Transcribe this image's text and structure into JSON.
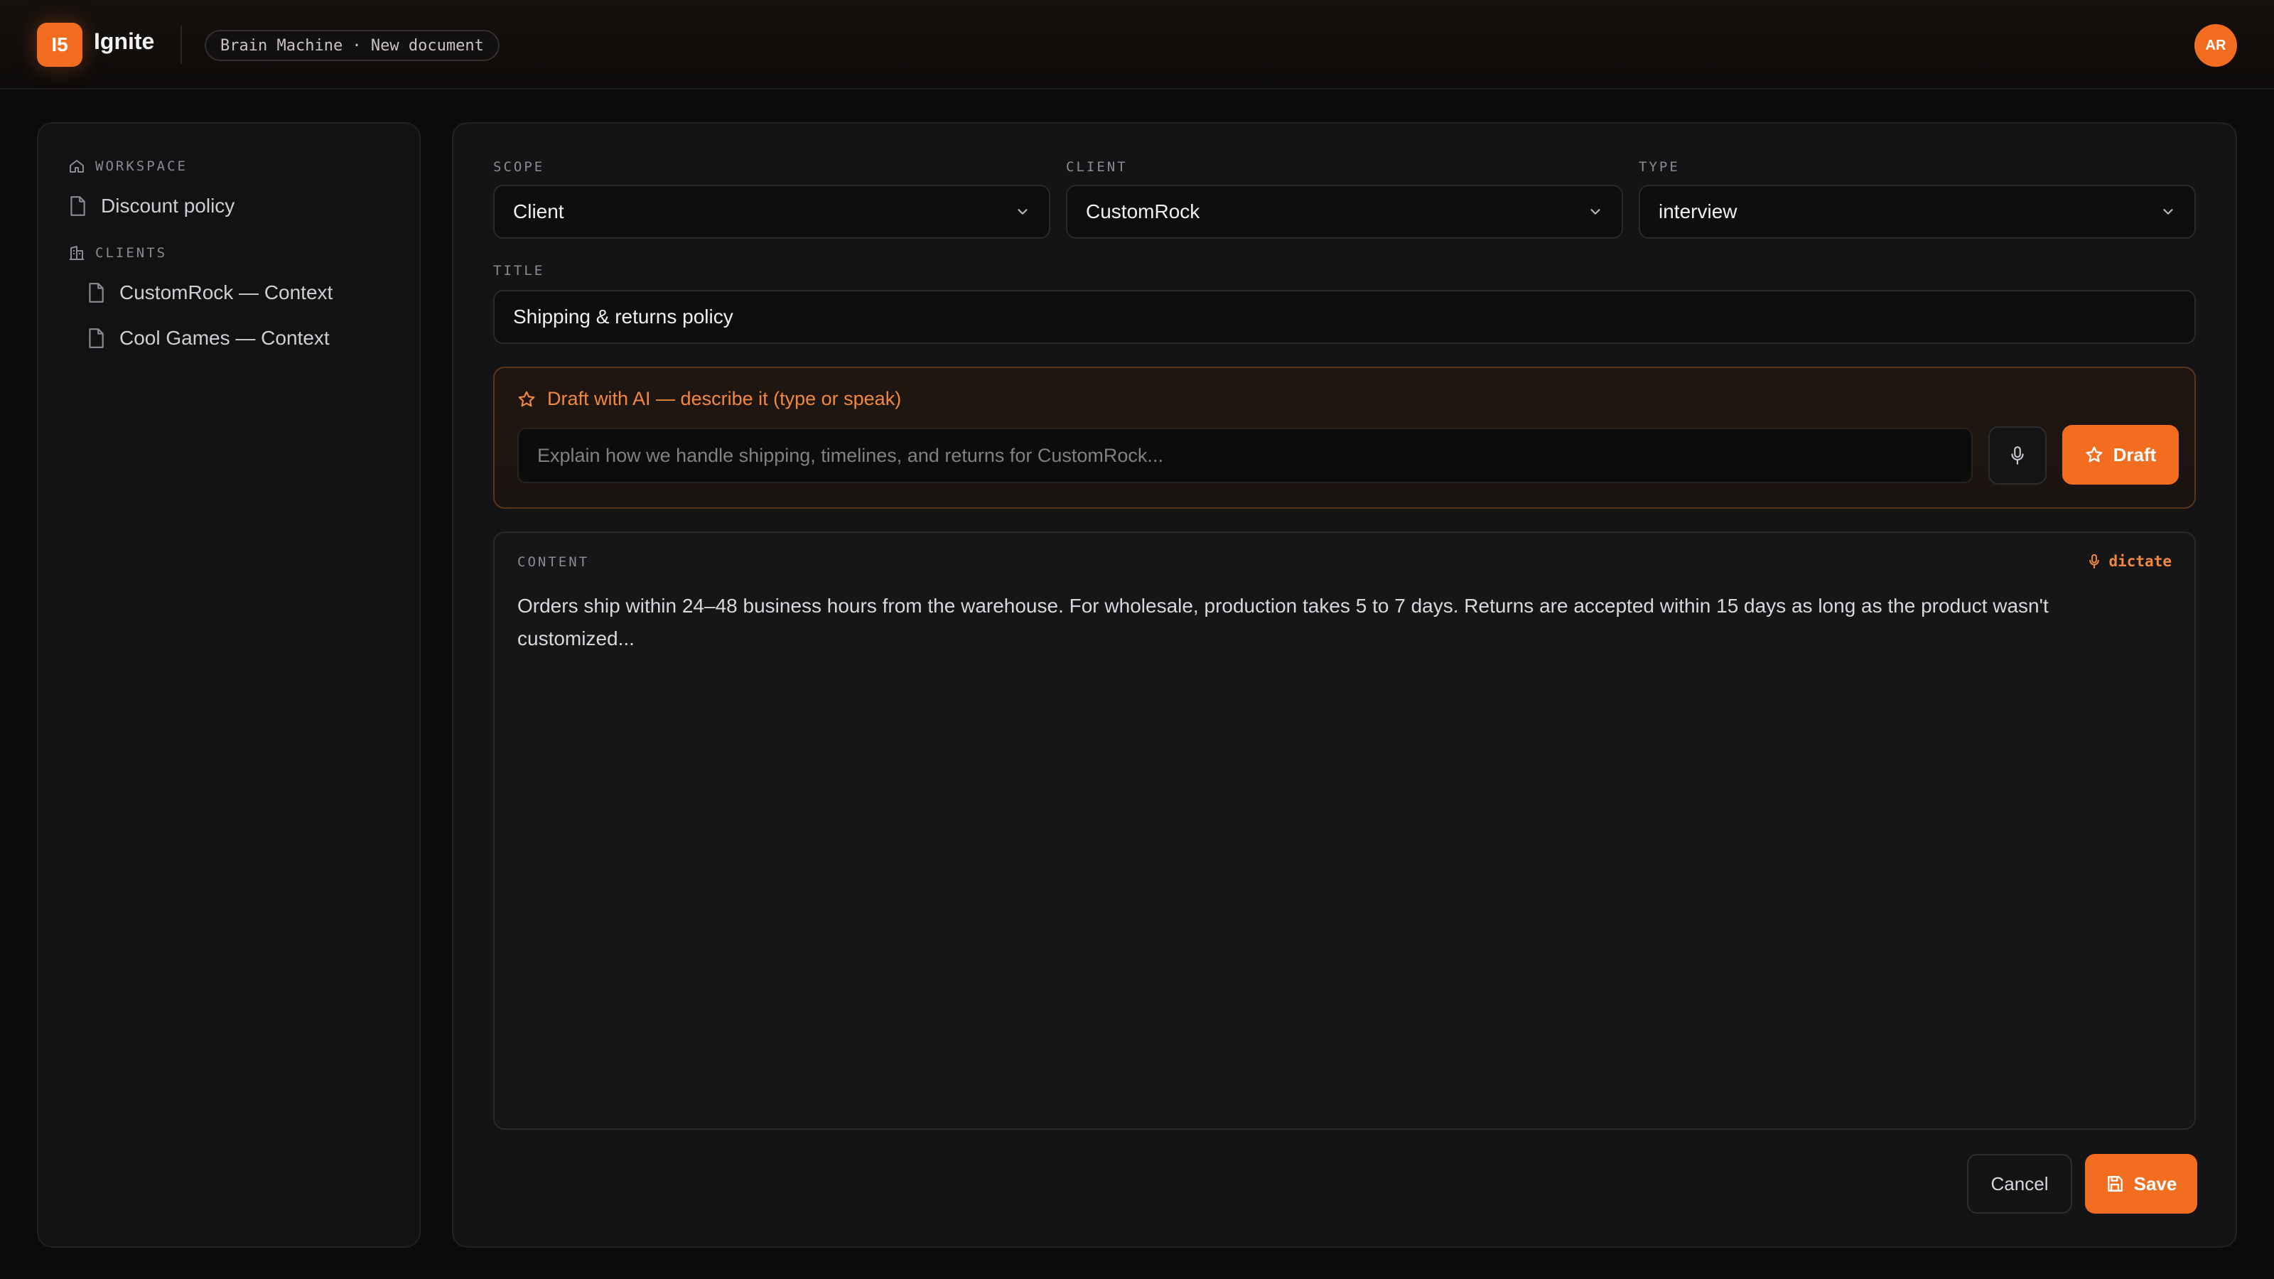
{
  "header": {
    "logo_text": "I5",
    "app_name": "Ignite",
    "breadcrumb": "Brain Machine · New document",
    "avatar_initials": "AR"
  },
  "sidebar": {
    "workspace_label": "WORKSPACE",
    "workspace_items": [
      {
        "label": "Discount policy",
        "icon": "file-icon"
      }
    ],
    "clients_label": "CLIENTS",
    "client_items": [
      {
        "label": "CustomRock — Context",
        "icon": "file-icon"
      },
      {
        "label": "Cool Games — Context",
        "icon": "file-icon"
      }
    ]
  },
  "form": {
    "scope": {
      "label": "SCOPE",
      "value": "Client"
    },
    "client": {
      "label": "CLIENT",
      "value": "CustomRock"
    },
    "type": {
      "label": "TYPE",
      "value": "interview"
    },
    "title": {
      "label": "TITLE",
      "value": "Shipping & returns policy"
    }
  },
  "ai_draft": {
    "heading": "Draft with AI — describe it (type or speak)",
    "placeholder": "Explain how we handle shipping, timelines, and returns for CustomRock...",
    "button_label": "Draft"
  },
  "content": {
    "label": "CONTENT",
    "dictate_label": "dictate",
    "text": "Orders ship within 24–48 business hours from the warehouse. For wholesale, production takes 5 to 7 days. Returns are accepted within 15 days as long as the product wasn't customized..."
  },
  "actions": {
    "cancel_label": "Cancel",
    "save_label": "Save"
  },
  "colors": {
    "accent": "#f26d1f",
    "accent_text": "#f2883f",
    "background": "#0b0b0c",
    "panel": "#141416"
  }
}
